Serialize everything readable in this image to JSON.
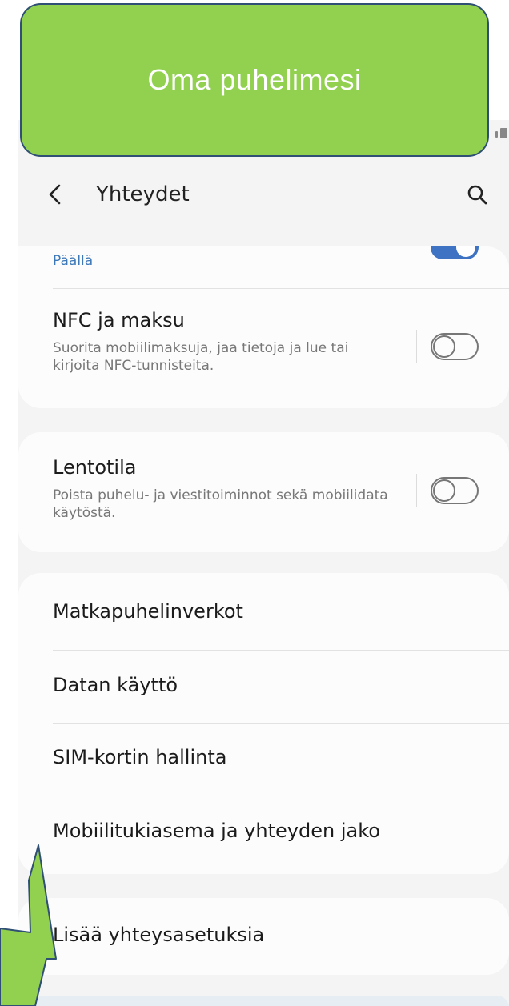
{
  "banner": {
    "text": "Oma puhelimesi",
    "color": "#92d050",
    "border_color": "#2f4f74"
  },
  "appbar": {
    "back_icon": "chevron-left-icon",
    "title": "Yhteydet",
    "search_icon": "search-icon"
  },
  "sections": {
    "top_toggle": {
      "status": "Päällä",
      "switch_on": true
    },
    "nfc": {
      "title": "NFC ja maksu",
      "subtitle": "Suorita mobiilimaksuja, jaa tietoja ja lue tai kirjoita NFC-tunnisteita.",
      "switch_on": false
    },
    "airplane": {
      "title": "Lentotila",
      "subtitle": "Poista puhelu- ja viestitoiminnot sekä mobiilidata käytöstä.",
      "switch_on": false
    },
    "menu": [
      {
        "label": "Matkapuhelinverkot"
      },
      {
        "label": "Datan käyttö"
      },
      {
        "label": "SIM-kortin hallinta"
      },
      {
        "label": "Mobiilitukiasema ja yhteyden jako"
      }
    ],
    "more": {
      "label": "Lisää yhteysasetuksia"
    }
  },
  "colors": {
    "accent": "#3e73c4",
    "status_text": "#3d78b8",
    "pointer_fill": "#92d050"
  }
}
